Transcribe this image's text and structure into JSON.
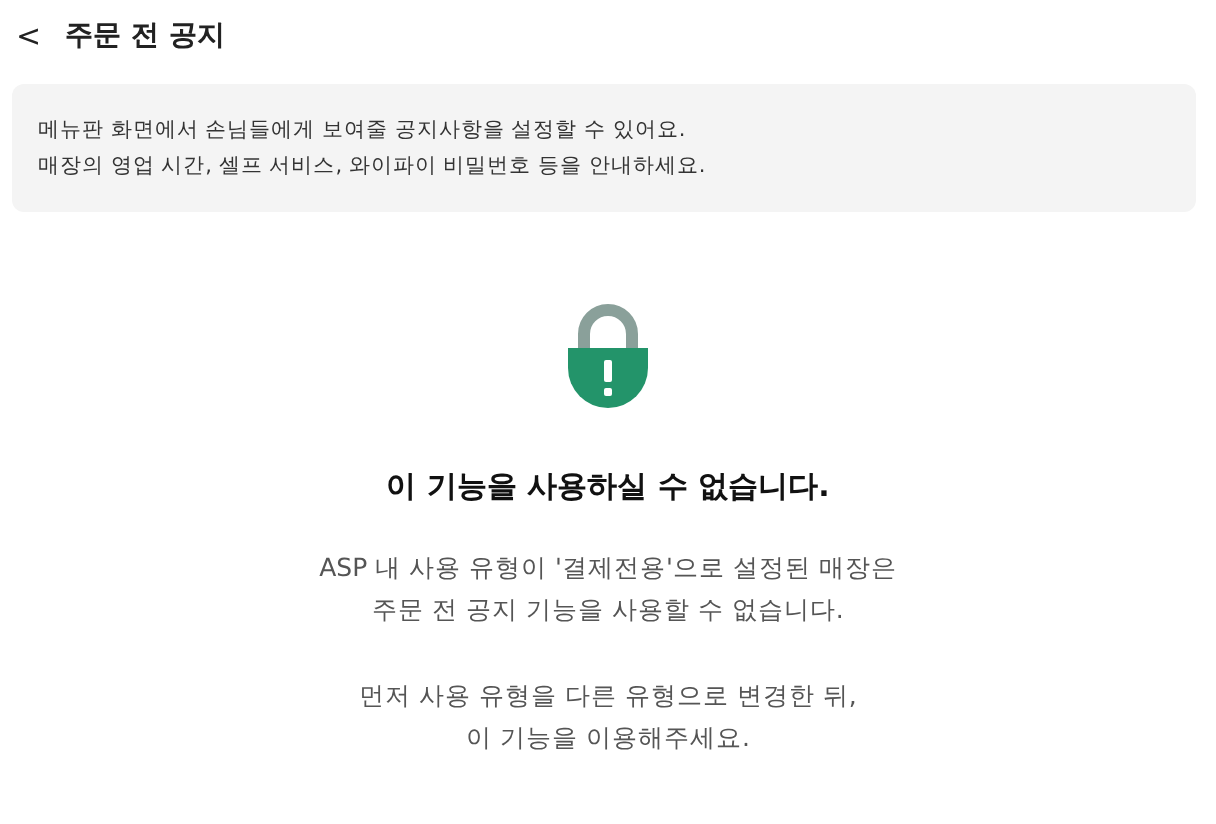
{
  "header": {
    "back_icon": "<",
    "title": "주문 전 공지"
  },
  "info_box": {
    "text": "메뉴판 화면에서 손님들에게 보여줄 공지사항을 설정할 수 있어요.\n매장의 영업 시간, 셀프 서비스, 와이파이 비밀번호 등을 안내하세요."
  },
  "notice": {
    "title": "이 기능을 사용하실 수 없습니다.",
    "paragraphs": [
      "ASP 내 사용 유형이 '결제전용'으로 설정된 매장은\n주문 전 공지 기능을 사용할 수 없습니다.",
      "먼저 사용 유형을 다른 유형으로 변경한 뒤,\n이 기능을 이용해주세요."
    ]
  }
}
